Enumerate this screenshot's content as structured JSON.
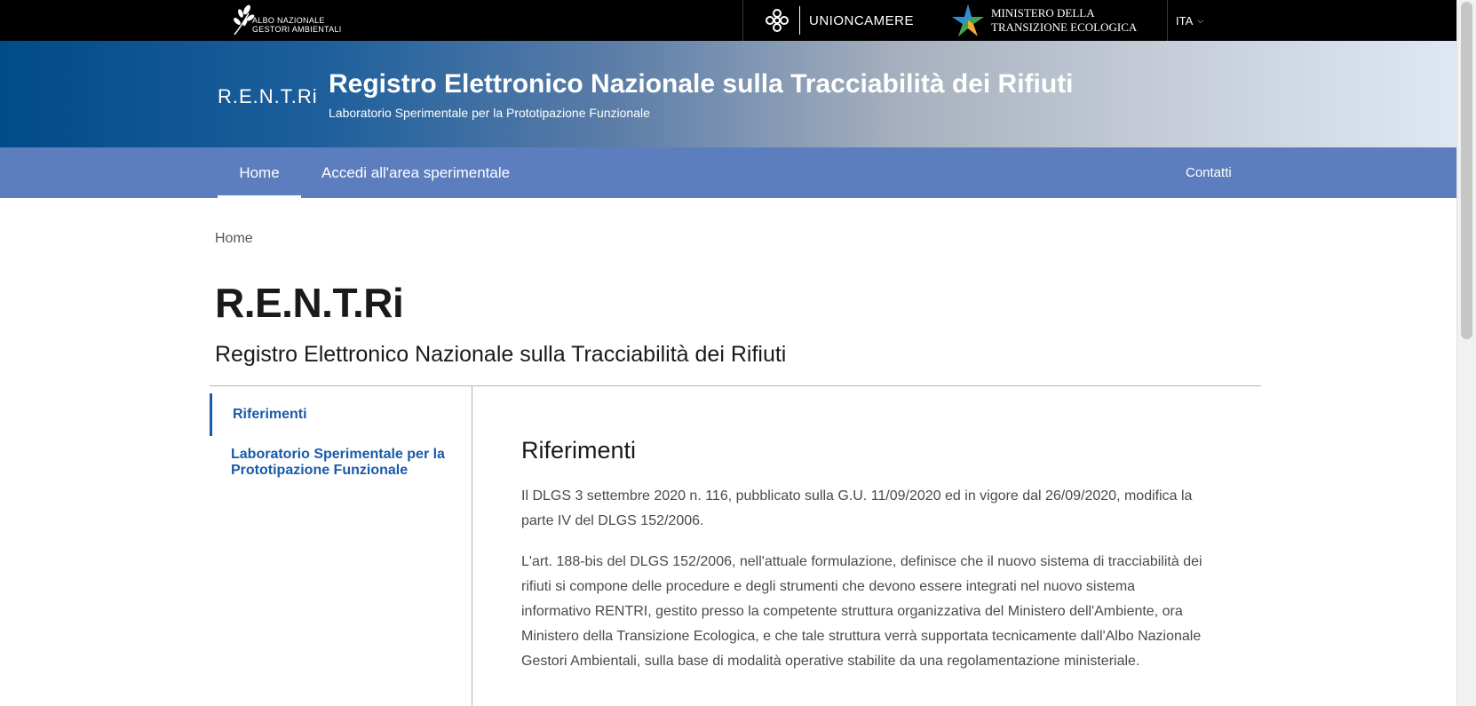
{
  "topbar": {
    "albo": {
      "line1": "Albo Nazionale",
      "line2": "Gestori Ambientali"
    },
    "unioncamere": "UNIONCAMERE",
    "ministero": {
      "line1": "Ministero della",
      "line2": "Transizione Ecologica"
    },
    "language": "ITA"
  },
  "header": {
    "short_name": "R.E.N.T.Ri",
    "title": "Registro Elettronico Nazionale sulla Tracciabilità dei Rifiuti",
    "subtitle": "Laboratorio Sperimentale per la Prototipazione Funzionale"
  },
  "nav": {
    "items": [
      {
        "label": "Home"
      },
      {
        "label": "Accedi all'area sperimentale"
      }
    ],
    "contact": "Contatti"
  },
  "breadcrumb": "Home",
  "page": {
    "title": "R.E.N.T.Ri",
    "subtitle": "Registro Elettronico Nazionale sulla Tracciabilità dei Rifiuti"
  },
  "sidebar": {
    "items": [
      {
        "label": "Riferimenti"
      },
      {
        "label": "Laboratorio Sperimentale per la Prototipazione Funzionale"
      }
    ]
  },
  "content": {
    "heading": "Riferimenti",
    "paragraphs": [
      "Il DLGS 3 settembre 2020 n. 116, pubblicato sulla G.U. 11/09/2020 ed in vigore dal 26/09/2020, modifica la parte IV del DLGS 152/2006.",
      "L'art. 188-bis del DLGS 152/2006, nell'attuale formulazione, definisce che il nuovo sistema di tracciabilità dei rifiuti si compone delle procedure e degli strumenti che devono essere integrati nel nuovo sistema informativo RENTRI, gestito presso la competente struttura organizzativa del Ministero dell'Ambiente, ora Ministero della Transizione Ecologica, e che tale struttura verrà supportata tecnicamente dall'Albo Nazionale Gestori Ambientali, sulla base di modalità operative stabilite da una regolamentazione ministeriale."
    ]
  }
}
